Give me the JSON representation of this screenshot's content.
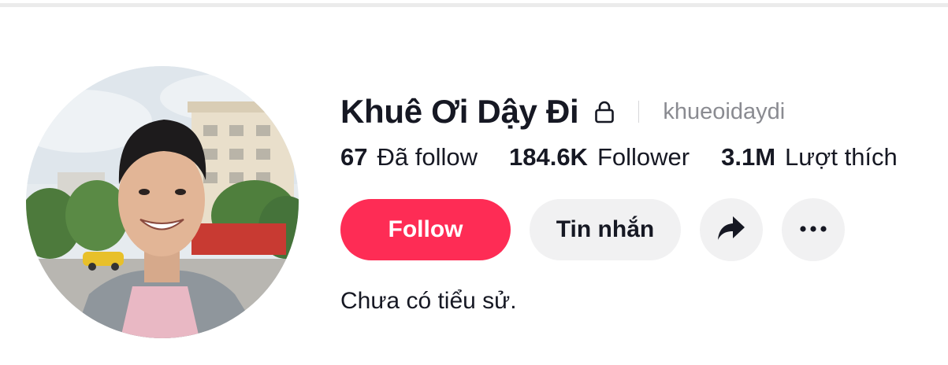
{
  "profile": {
    "display_name": "Khuê Ơi Dậy Đi",
    "username": "khueoidaydi",
    "bio": "Chưa có tiểu sử."
  },
  "stats": [
    {
      "value": "67",
      "label": "Đã follow"
    },
    {
      "value": "184.6K",
      "label": "Follower"
    },
    {
      "value": "3.1M",
      "label": "Lượt thích"
    }
  ],
  "actions": {
    "follow_label": "Follow",
    "message_label": "Tin nhắn",
    "share_icon": "share-arrow-icon",
    "more_icon": "more-dots-icon"
  },
  "colors": {
    "accent": "#fe2c55",
    "button_gray": "#f1f1f2",
    "text_primary": "#161823",
    "text_secondary": "#8a8b91"
  }
}
